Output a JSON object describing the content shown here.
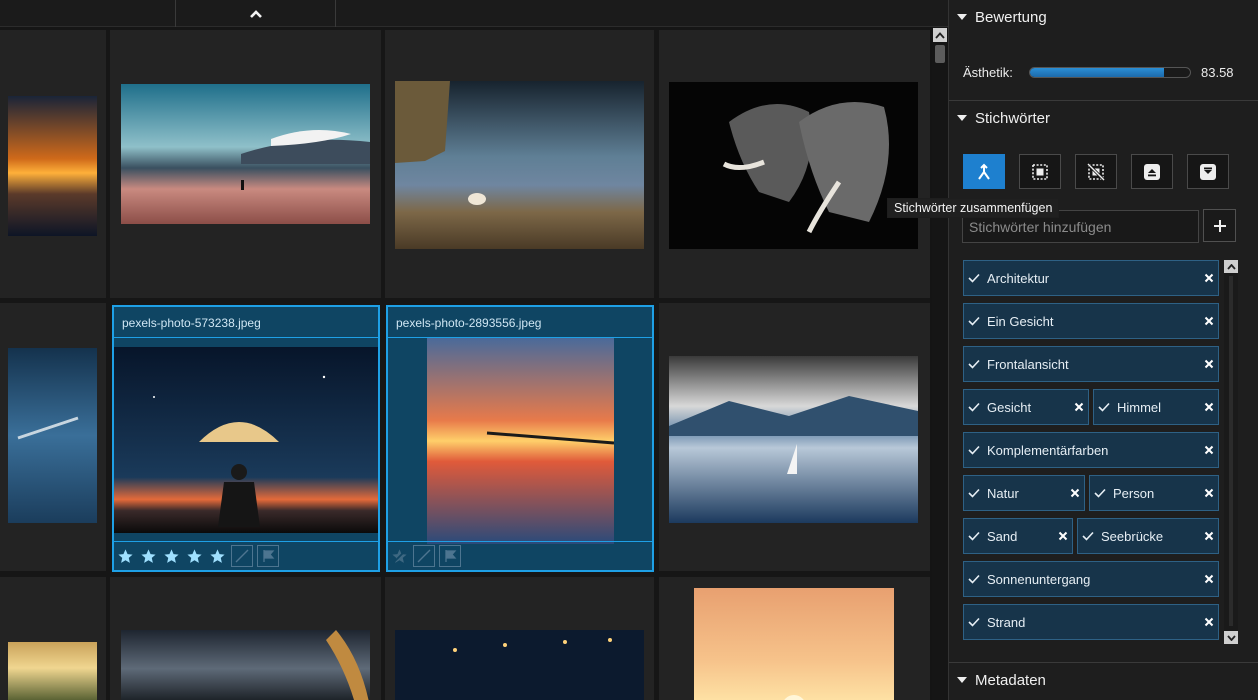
{
  "grid": {
    "row2": [
      {
        "filename": "pexels-photo-573238.jpeg",
        "rating": 5
      },
      {
        "filename": "pexels-photo-2893556.jpeg",
        "rating": 0
      }
    ]
  },
  "panel": {
    "rating_section": {
      "title": "Bewertung",
      "aesthetic_label": "Ästhetik:",
      "aesthetic_value": "83.58",
      "aesthetic_fraction": 0.84
    },
    "keywords_section": {
      "title": "Stichwörter",
      "tooltip": "Stichwörter zusammenfügen",
      "input_placeholder": "Stichwörter hinzufügen",
      "tags": [
        {
          "label": "Architektur"
        },
        {
          "label": "Ein Gesicht"
        },
        {
          "label": "Frontalansicht"
        },
        {
          "label": "Gesicht"
        },
        {
          "label": "Himmel"
        },
        {
          "label": "Komplementärfarben"
        },
        {
          "label": "Natur"
        },
        {
          "label": "Person"
        },
        {
          "label": "Sand"
        },
        {
          "label": "Seebrücke"
        },
        {
          "label": "Sonnenuntergang"
        },
        {
          "label": "Strand"
        }
      ]
    },
    "metadata_section": {
      "title": "Metadaten"
    }
  },
  "colors": {
    "accent": "#1ea0e6",
    "selected_bg": "#0f4563",
    "tag_bg": "#17344a",
    "star": "#9fe0ff"
  }
}
